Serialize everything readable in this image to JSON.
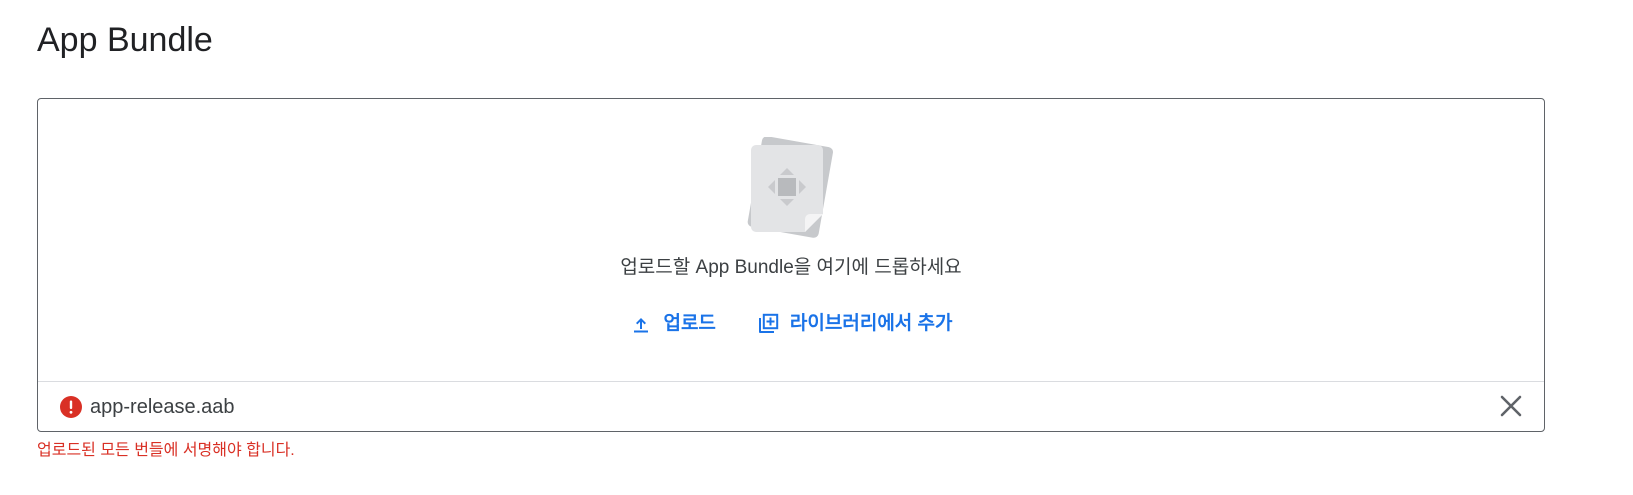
{
  "page": {
    "title": "App Bundle"
  },
  "dropzone": {
    "prompt": "업로드할 App Bundle을 여기에 드롭하세요",
    "upload_label": "업로드",
    "add_from_library_label": "라이브러리에서 추가",
    "illustration_icon": "app-bundle-illustration"
  },
  "file": {
    "name": "app-release.aab",
    "status_icon": "error-icon",
    "remove_icon": "close-icon"
  },
  "error": {
    "message": "업로드된 모든 번들에 서명해야 합니다."
  },
  "colors": {
    "accent": "#1a73e8",
    "error": "#d93025",
    "border": "#5f6368",
    "divider": "#dadce0"
  }
}
